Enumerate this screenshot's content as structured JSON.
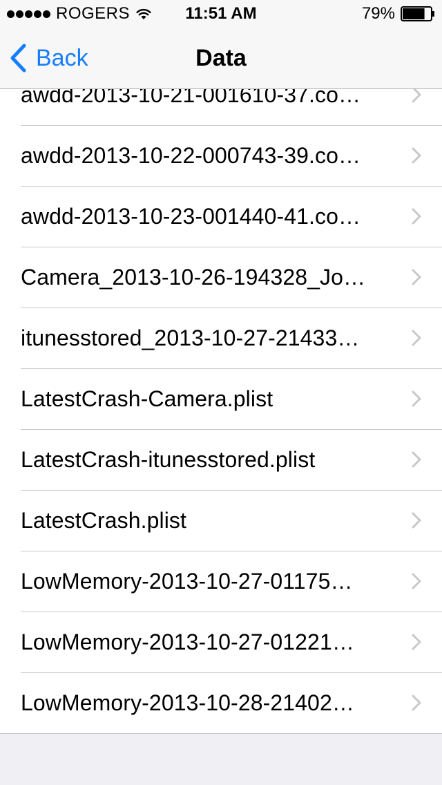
{
  "status_bar": {
    "carrier": "ROGERS",
    "time": "11:51 AM",
    "battery_percent": "79%",
    "battery_level": 0.79,
    "signal_bars": 5
  },
  "nav": {
    "back_label": "Back",
    "title": "Data"
  },
  "colors": {
    "accent": "#157efb",
    "chevron": "#c7c7cc"
  },
  "items": [
    {
      "label": "awdd-2013-10-21-001610-37.co…"
    },
    {
      "label": "awdd-2013-10-22-000743-39.co…"
    },
    {
      "label": "awdd-2013-10-23-001440-41.co…"
    },
    {
      "label": "Camera_2013-10-26-194328_Jo…"
    },
    {
      "label": "itunesstored_2013-10-27-21433…"
    },
    {
      "label": "LatestCrash-Camera.plist"
    },
    {
      "label": "LatestCrash-itunesstored.plist"
    },
    {
      "label": "LatestCrash.plist"
    },
    {
      "label": "LowMemory-2013-10-27-01175…"
    },
    {
      "label": "LowMemory-2013-10-27-01221…"
    },
    {
      "label": "LowMemory-2013-10-28-21402…"
    }
  ]
}
